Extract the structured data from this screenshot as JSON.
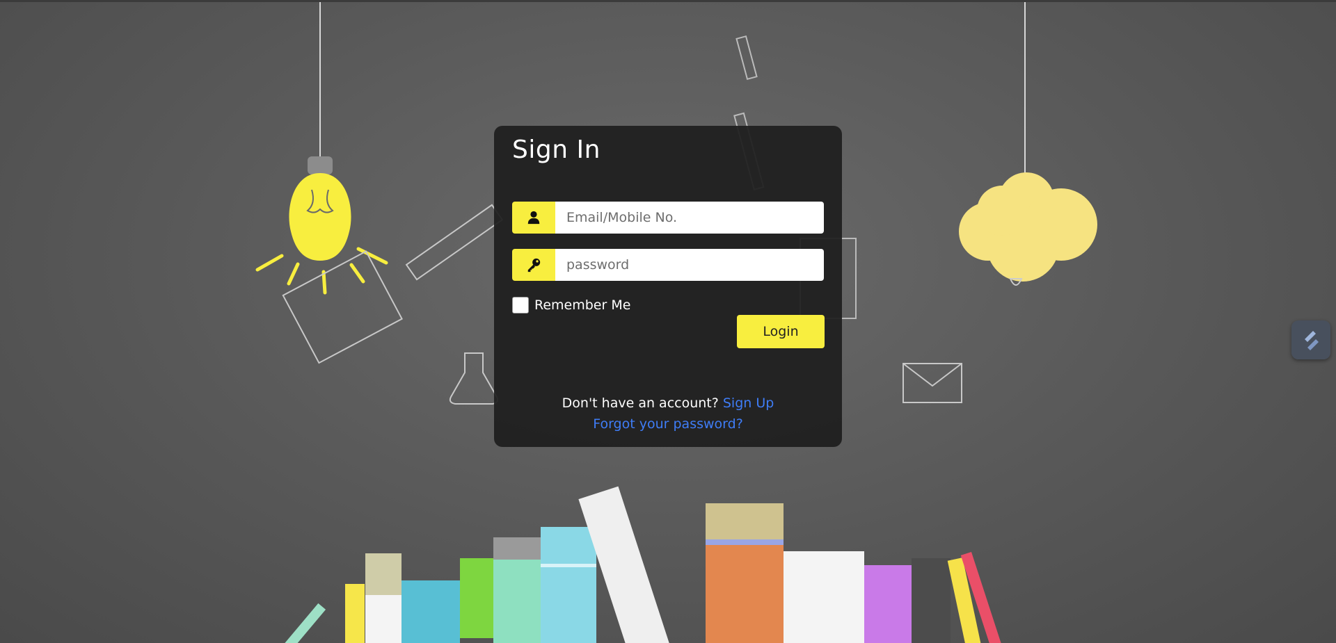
{
  "form": {
    "title": "Sign In",
    "email_placeholder": "Email/Mobile No.",
    "email_value": "",
    "password_placeholder": "password",
    "password_value": "",
    "remember_label": "Remember Me",
    "remember_checked": false,
    "login_label": "Login",
    "no_account_text": "Don't have an account?",
    "signup_label": "Sign Up",
    "forgot_label": "Forgot your password?"
  },
  "icons": {
    "email_icon": "user-icon",
    "password_icon": "key-icon",
    "side_widget_icon": "extension-icon"
  },
  "colors": {
    "accent": "#f8ee3f",
    "card_bg": "#1e1e1e",
    "link": "#3f7df7",
    "chalkboard": "#585858"
  }
}
